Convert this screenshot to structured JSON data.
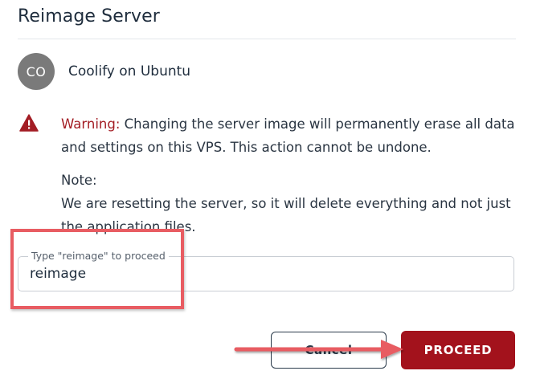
{
  "dialog": {
    "title": "Reimage Server"
  },
  "server": {
    "avatar_initials": "CO",
    "name": "Coolify on Ubuntu"
  },
  "warning": {
    "label": "Warning:",
    "text": " Changing the server image will permanently erase all data and settings on this VPS. This action cannot be undone."
  },
  "note": {
    "heading": "Note:",
    "text": "We are resetting the server, so it will delete everything and not just the application files."
  },
  "confirm_field": {
    "label": "Type \"reimage\" to proceed",
    "value": "reimage"
  },
  "buttons": {
    "cancel": "Cancel",
    "proceed": "PROCEED"
  },
  "icons": {
    "warning": "warning-triangle-icon"
  },
  "colors": {
    "warning_accent": "#a31d24",
    "proceed_bg": "#a3121c",
    "annotation_red": "#e85c62"
  }
}
